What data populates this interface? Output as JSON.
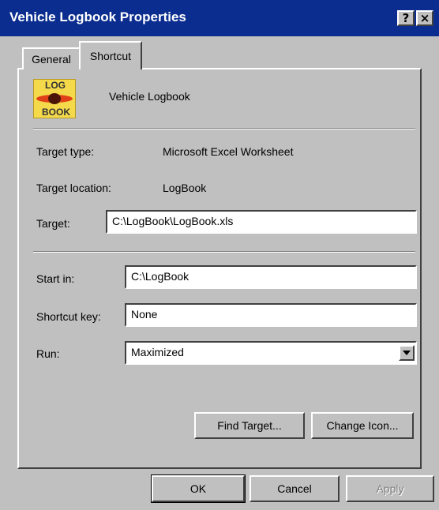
{
  "window": {
    "title": "Vehicle Logbook Properties",
    "help_label": "?",
    "close_label": "×"
  },
  "tabs": [
    {
      "label": "General",
      "active": false
    },
    {
      "label": "Shortcut",
      "active": true
    }
  ],
  "icon": {
    "name": "vehicle-logbook-icon",
    "top_text": "LOG",
    "bottom_text": "BOOK",
    "colors": {
      "background": "#f4d94a",
      "stripe": "#e04018"
    }
  },
  "shortcut_name": "Vehicle Logbook",
  "info": {
    "target_type_label": "Target type:",
    "target_type_value": "Microsoft Excel Worksheet",
    "target_location_label": "Target location:",
    "target_location_value": "LogBook"
  },
  "fields": {
    "target_label": "Target:",
    "target_value": "C:\\LogBook\\LogBook.xls",
    "start_in_label": "Start in:",
    "start_in_value": "C:\\LogBook",
    "shortcut_key_label": "Shortcut key:",
    "shortcut_key_value": "None",
    "run_label": "Run:",
    "run_value": "Maximized"
  },
  "buttons": {
    "find_target": "Find Target...",
    "change_icon": "Change Icon...",
    "ok": "OK",
    "cancel": "Cancel",
    "apply": "Apply"
  },
  "colors": {
    "titlebar": "#0a2d8f",
    "face": "#c0c0c0"
  }
}
